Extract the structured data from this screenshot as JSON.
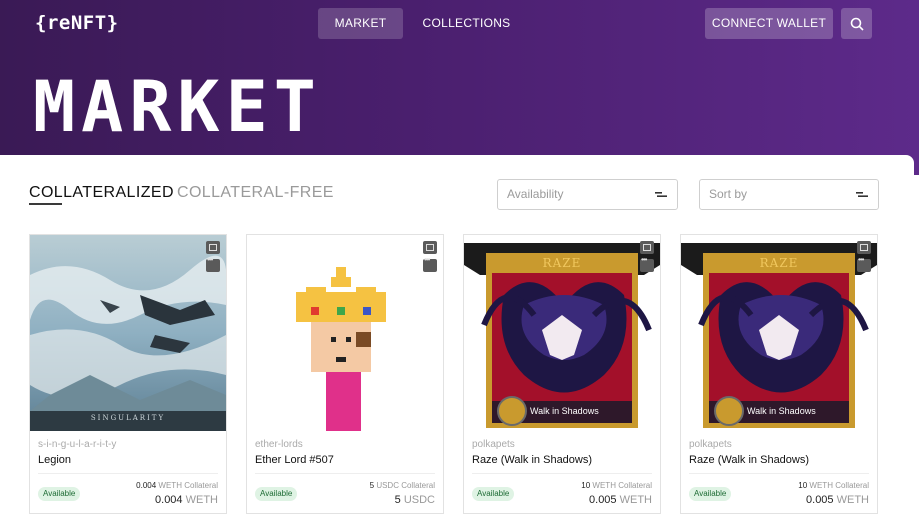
{
  "header": {
    "logo": "{reNFT}",
    "nav": [
      {
        "label": "MARKET",
        "active": true
      },
      {
        "label": "COLLECTIONS",
        "active": false
      }
    ],
    "connect_wallet": "CONNECT WALLET",
    "search_icon": "search-icon"
  },
  "hero": {
    "title": "MARKET"
  },
  "tabs": [
    {
      "label": "COLLATERALIZED",
      "active": true
    },
    {
      "label": "COLLATERAL-FREE",
      "active": false
    }
  ],
  "filters": {
    "availability_placeholder": "Availability",
    "sort_placeholder": "Sort by"
  },
  "cards": [
    {
      "collection": "s-i-n-g-u-l-a-r-i-t-y",
      "name": "Legion",
      "image_caption": "SINGULARITY",
      "status": "Available",
      "collateral_amount": "0.004",
      "collateral_label": "WETH Collateral",
      "price_amount": "0.004",
      "price_unit": "WETH"
    },
    {
      "collection": "ether-lords",
      "name": "Ether Lord #507",
      "status": "Available",
      "collateral_amount": "5",
      "collateral_label": "USDC Collateral",
      "price_amount": "5",
      "price_unit": "USDC"
    },
    {
      "collection": "polkapets",
      "name": "Raze (Walk in Shadows)",
      "image_title": "RAZE",
      "image_caption": "Walk in Shadows",
      "status": "Available",
      "collateral_amount": "10",
      "collateral_label": "WETH Collateral",
      "price_amount": "0.005",
      "price_unit": "WETH"
    },
    {
      "collection": "polkapets",
      "name": "Raze (Walk in Shadows)",
      "image_title": "RAZE",
      "image_caption": "Walk in Shadows",
      "status": "Available",
      "collateral_amount": "10",
      "collateral_label": "WETH Collateral",
      "price_amount": "0.005",
      "price_unit": "WETH"
    }
  ],
  "colors": {
    "hero_start": "#3a1a55",
    "hero_end": "#5d2a8a",
    "available_bg": "#dff3e4",
    "available_text": "#1d6b34"
  }
}
